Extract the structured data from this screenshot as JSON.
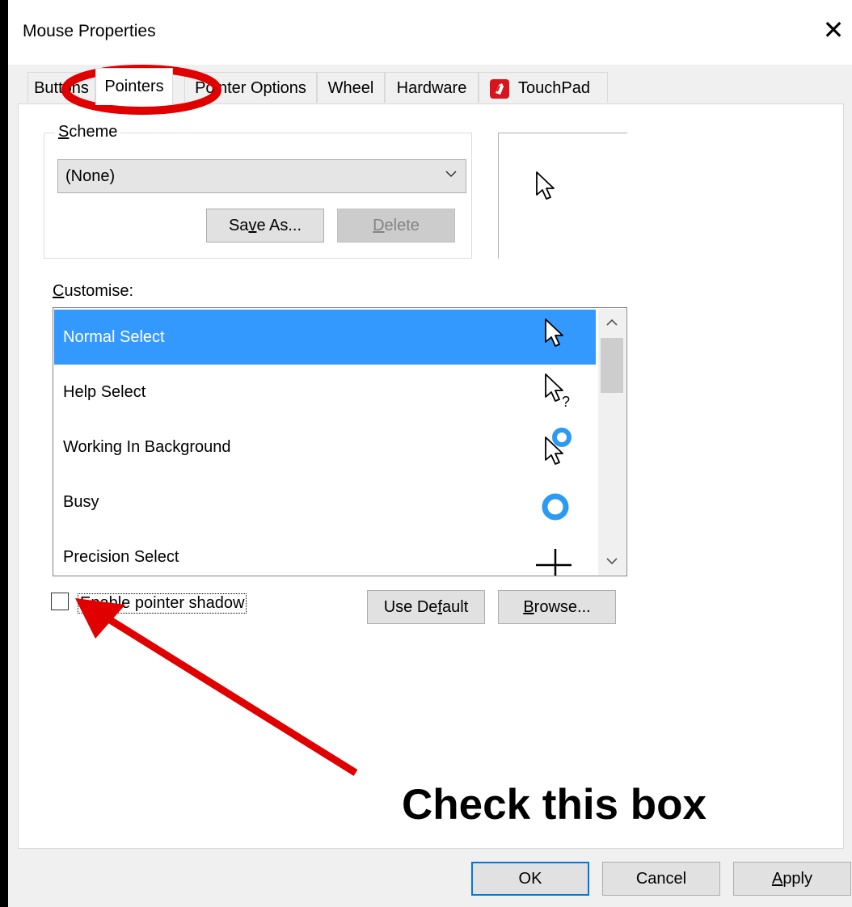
{
  "window": {
    "title": "Mouse Properties",
    "close_glyph": "✕"
  },
  "tabs": [
    {
      "label": "Buttons",
      "active": false
    },
    {
      "label": "Pointers",
      "active": true
    },
    {
      "label": "Pointer Options",
      "active": false
    },
    {
      "label": "Wheel",
      "active": false
    },
    {
      "label": "Hardware",
      "active": false
    },
    {
      "label": "TouchPad",
      "active": false,
      "icon": "touchpad-icon"
    }
  ],
  "scheme": {
    "label_first": "S",
    "label_rest": "cheme",
    "selected": "(None)",
    "save_as": {
      "pre": "Sa",
      "ul": "v",
      "post": "e As..."
    },
    "delete": {
      "pre": "",
      "ul": "D",
      "post": "elete"
    }
  },
  "customise": {
    "label_first": "C",
    "label_rest": "ustomise:",
    "items": [
      {
        "label": "Normal Select",
        "icon": "arrow-cursor-icon",
        "selected": true
      },
      {
        "label": "Help Select",
        "icon": "help-cursor-icon",
        "selected": false
      },
      {
        "label": "Working In Background",
        "icon": "working-cursor-icon",
        "selected": false
      },
      {
        "label": "Busy",
        "icon": "busy-cursor-icon",
        "selected": false
      },
      {
        "label": "Precision Select",
        "icon": "crosshair-cursor-icon",
        "selected": false
      }
    ]
  },
  "shadow": {
    "label": "Enable pointer shadow",
    "checked": false
  },
  "buttons": {
    "use_default": {
      "pre": "Use De",
      "ul": "f",
      "post": "ault"
    },
    "browse": {
      "pre": "",
      "ul": "B",
      "post": "rowse..."
    },
    "ok": "OK",
    "cancel": "Cancel",
    "apply": {
      "pre": "",
      "ul": "A",
      "post": "pply"
    }
  },
  "annotation": {
    "text": "Check this box",
    "color": "#e00000"
  },
  "colors": {
    "selection": "#3399ff",
    "accent": "#0078d7",
    "annotation_red": "#e00000",
    "busy_blue": "#2b9af3"
  }
}
